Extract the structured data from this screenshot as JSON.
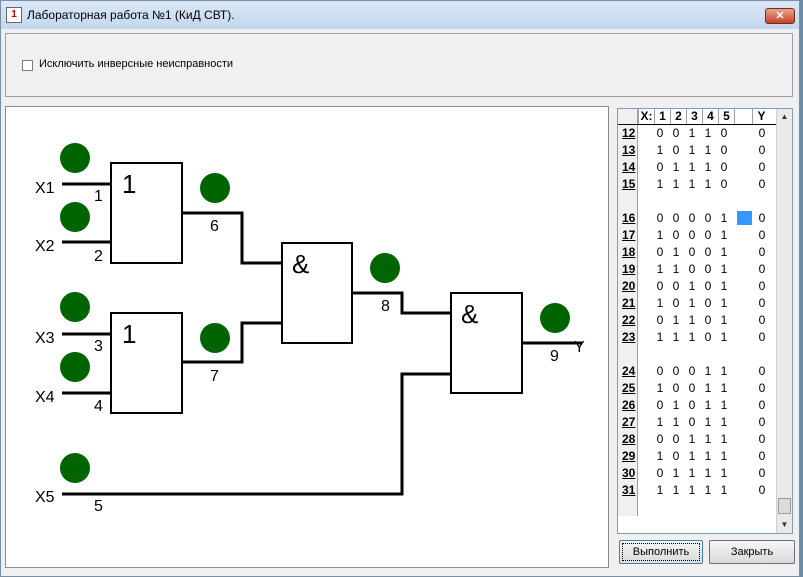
{
  "window": {
    "title": "Лабораторная работа №1 (КиД СВТ).",
    "close_glyph": "✕",
    "icon_glyph": "1"
  },
  "options": {
    "exclude_inverse_label": "Исключить инверсные неисправности",
    "exclude_inverse_checked": false
  },
  "circuit": {
    "inputs": [
      "X1",
      "X2",
      "X3",
      "X4",
      "X5"
    ],
    "output": "Y",
    "line_numbers": [
      "1",
      "2",
      "3",
      "4",
      "5",
      "6",
      "7",
      "8",
      "9"
    ],
    "gate1_symbol": "1",
    "gate2_symbol": "1",
    "gate3_symbol": "&",
    "gate4_symbol": "&",
    "indicator_color": "#006400"
  },
  "table": {
    "header": [
      "X:",
      "1",
      "2",
      "3",
      "4",
      "5",
      "",
      "Y"
    ],
    "rows": [
      {
        "n": "12",
        "x": [
          "0",
          "0",
          "1",
          "1",
          "0"
        ],
        "y": "0"
      },
      {
        "n": "13",
        "x": [
          "1",
          "0",
          "1",
          "1",
          "0"
        ],
        "y": "0"
      },
      {
        "n": "14",
        "x": [
          "0",
          "1",
          "1",
          "1",
          "0"
        ],
        "y": "0"
      },
      {
        "n": "15",
        "x": [
          "1",
          "1",
          "1",
          "1",
          "0"
        ],
        "y": "0"
      },
      {
        "n": "",
        "x": [
          "",
          "",
          "",
          "",
          ""
        ],
        "y": ""
      },
      {
        "n": "16",
        "x": [
          "0",
          "0",
          "0",
          "0",
          "1"
        ],
        "y": "0",
        "selected": true
      },
      {
        "n": "17",
        "x": [
          "1",
          "0",
          "0",
          "0",
          "1"
        ],
        "y": "0"
      },
      {
        "n": "18",
        "x": [
          "0",
          "1",
          "0",
          "0",
          "1"
        ],
        "y": "0"
      },
      {
        "n": "19",
        "x": [
          "1",
          "1",
          "0",
          "0",
          "1"
        ],
        "y": "0"
      },
      {
        "n": "20",
        "x": [
          "0",
          "0",
          "1",
          "0",
          "1"
        ],
        "y": "0"
      },
      {
        "n": "21",
        "x": [
          "1",
          "0",
          "1",
          "0",
          "1"
        ],
        "y": "0"
      },
      {
        "n": "22",
        "x": [
          "0",
          "1",
          "1",
          "0",
          "1"
        ],
        "y": "0"
      },
      {
        "n": "23",
        "x": [
          "1",
          "1",
          "1",
          "0",
          "1"
        ],
        "y": "0"
      },
      {
        "n": "",
        "x": [
          "",
          "",
          "",
          "",
          ""
        ],
        "y": ""
      },
      {
        "n": "24",
        "x": [
          "0",
          "0",
          "0",
          "1",
          "1"
        ],
        "y": "0"
      },
      {
        "n": "25",
        "x": [
          "1",
          "0",
          "0",
          "1",
          "1"
        ],
        "y": "0"
      },
      {
        "n": "26",
        "x": [
          "0",
          "1",
          "0",
          "1",
          "1"
        ],
        "y": "0"
      },
      {
        "n": "27",
        "x": [
          "1",
          "1",
          "0",
          "1",
          "1"
        ],
        "y": "0"
      },
      {
        "n": "28",
        "x": [
          "0",
          "0",
          "1",
          "1",
          "1"
        ],
        "y": "0"
      },
      {
        "n": "29",
        "x": [
          "1",
          "0",
          "1",
          "1",
          "1"
        ],
        "y": "0"
      },
      {
        "n": "30",
        "x": [
          "0",
          "1",
          "1",
          "1",
          "1"
        ],
        "y": "0"
      },
      {
        "n": "31",
        "x": [
          "1",
          "1",
          "1",
          "1",
          "1"
        ],
        "y": "0"
      },
      {
        "n": "",
        "x": [
          "",
          "",
          "",
          "",
          ""
        ],
        "y": ""
      }
    ],
    "scroll_up_glyph": "▲",
    "scroll_down_glyph": "▼",
    "selected_color": "#3399ff"
  },
  "buttons": {
    "execute": "Выполнить",
    "close": "Закрыть"
  }
}
